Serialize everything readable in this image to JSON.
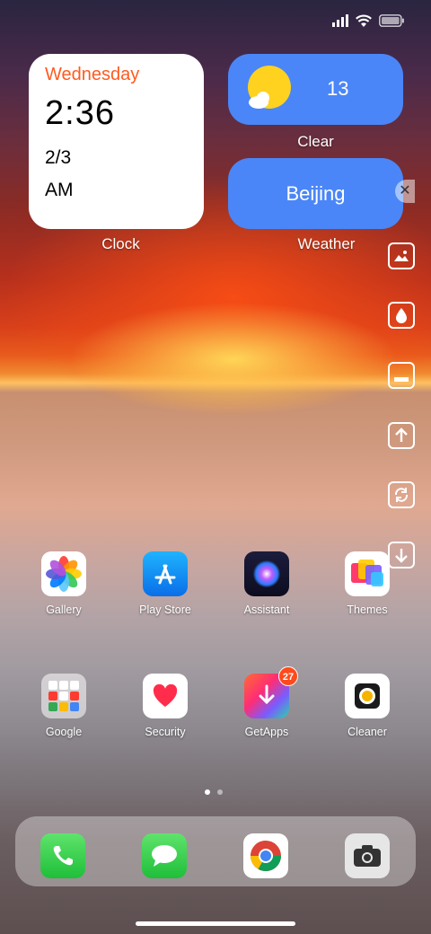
{
  "status_bar": {
    "signal_icon": "signal-icon",
    "wifi_icon": "wifi-icon",
    "battery_icon": "battery-icon"
  },
  "clock_widget": {
    "day": "Wednesday",
    "time": "2:36",
    "date": "2/3",
    "ampm": "AM",
    "label": "Clock"
  },
  "weather_widget": {
    "temperature": "13",
    "condition": "Clear",
    "city": "Beijing",
    "label": "Weather",
    "icon": "partly-sunny-icon"
  },
  "side_tools": [
    "image-icon",
    "drop-icon",
    "panel-icon",
    "upload-icon",
    "refresh-icon",
    "download-icon"
  ],
  "apps": {
    "row1": [
      {
        "label": "Gallery",
        "icon": "gallery-icon"
      },
      {
        "label": "Play Store",
        "icon": "play-store-icon"
      },
      {
        "label": "Assistant",
        "icon": "assistant-icon"
      },
      {
        "label": "Themes",
        "icon": "themes-icon"
      }
    ],
    "row2": [
      {
        "label": "Google",
        "icon": "google-folder-icon"
      },
      {
        "label": "Security",
        "icon": "security-icon"
      },
      {
        "label": "GetApps",
        "icon": "getapps-icon",
        "badge": "27"
      },
      {
        "label": "Cleaner",
        "icon": "cleaner-icon"
      }
    ]
  },
  "dock": [
    "phone-icon",
    "messages-icon",
    "chrome-icon",
    "camera-icon"
  ],
  "colors": {
    "widget_blue": "#4a86f7",
    "day_orange": "#ff5a1f",
    "badge_red": "#ff4a1c"
  }
}
